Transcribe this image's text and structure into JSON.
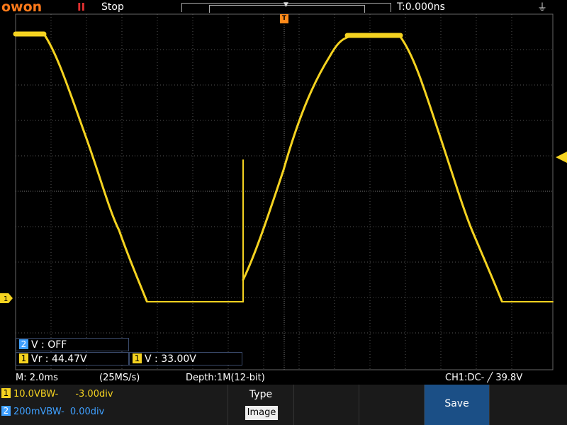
{
  "header": {
    "logo": "owon",
    "run_state_icon": "pause-icon",
    "run_state": "Stop",
    "time_offset": "T:0.000ns",
    "usb_icon": "usb-icon"
  },
  "markers": {
    "trigger_label": "T",
    "ch1_label": "1"
  },
  "measurements": {
    "ch2_v": {
      "channel": "2",
      "text": "V : OFF"
    },
    "ch1_vr": {
      "channel": "1",
      "text": "Vr : 44.47V"
    },
    "ch1_v": {
      "channel": "1",
      "text": "V : 33.00V"
    }
  },
  "info": {
    "timebase": "M: 2.0ms",
    "sample_rate": "(25MS/s)",
    "depth": "Depth:1M(12-bit)",
    "trigger": "CH1:DC- ╱ 39.8V"
  },
  "channels": [
    {
      "id": "1",
      "scale": "10.0V",
      "bw": "BW-",
      "offset": "-3.00div",
      "color": "#f5d320"
    },
    {
      "id": "2",
      "scale": "200mV",
      "bw": "BW-",
      "offset": "0.00div",
      "color": "#3fa0ff"
    }
  ],
  "menu": {
    "type_label": "Type",
    "type_value": "Image",
    "save_label": "Save"
  },
  "colors": {
    "ch1": "#f5d320",
    "ch2": "#3fa0ff",
    "logo": "#ff7a1a",
    "trigger": "#ff8a1a",
    "save_button": "#1b4f86"
  }
}
